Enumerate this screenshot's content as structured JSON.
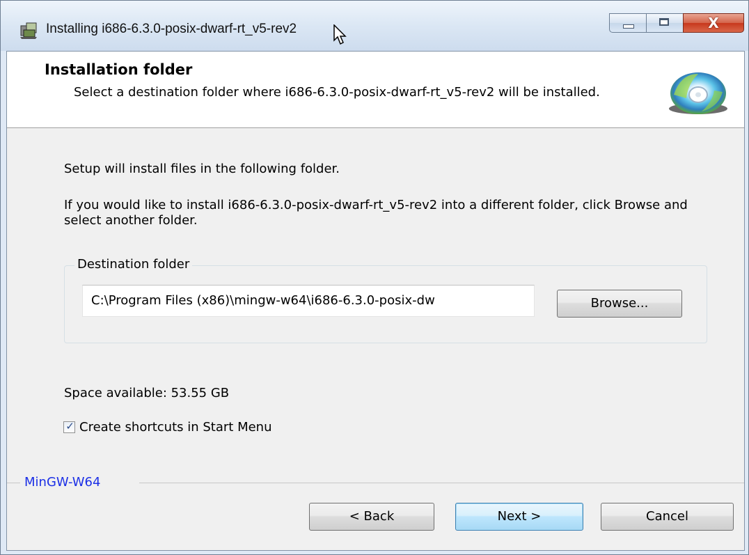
{
  "window": {
    "title": "Installing i686-6.3.0-posix-dwarf-rt_v5-rev2",
    "close_glyph": "X"
  },
  "header": {
    "title": "Installation folder",
    "subtitle": "Select a destination folder where i686-6.3.0-posix-dwarf-rt_v5-rev2 will be installed.",
    "icon": "cd-icon"
  },
  "body": {
    "intro": "Setup will install files in the following folder.",
    "instructions": "If you would like to install i686-6.3.0-posix-dwarf-rt_v5-rev2 into a different folder, click Browse and select another folder.",
    "destination_group_label": "Destination folder",
    "destination_path": "C:\\Program Files (x86)\\mingw-w64\\i686-6.3.0-posix-dw",
    "browse_label": "Browse...",
    "space_available": "Space available: 53.55 GB",
    "shortcuts_label": "Create shortcuts in Start Menu",
    "shortcuts_checked": true
  },
  "footer": {
    "brand": "MinGW-W64",
    "back_label": "< Back",
    "next_label": "Next >",
    "cancel_label": "Cancel"
  },
  "colors": {
    "brand_text": "#1b2fe6",
    "default_button_border": "#3c7fb1",
    "close_button": "#c7381d"
  }
}
